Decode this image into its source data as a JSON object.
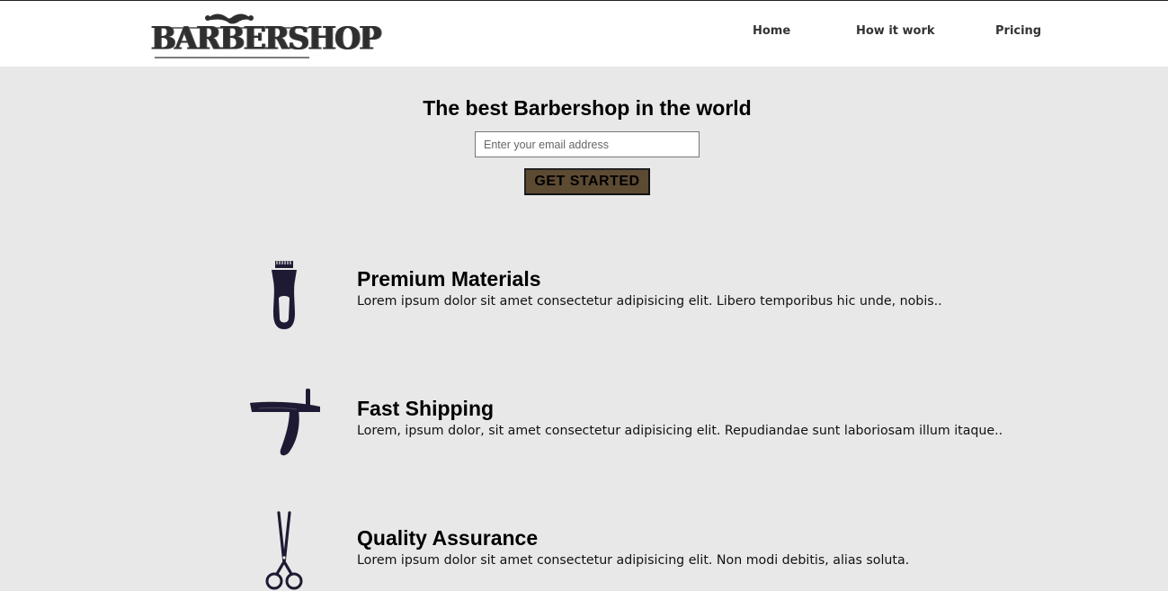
{
  "header": {
    "logo_text": "BARBERSHOP",
    "nav": [
      {
        "label": "Home"
      },
      {
        "label": "How it work"
      },
      {
        "label": "Pricing"
      }
    ]
  },
  "hero": {
    "title": "The best Barbershop in the world",
    "email_placeholder": "Enter your email address",
    "cta_label": "GET STARTED"
  },
  "features": [
    {
      "icon": "hair-clipper-icon",
      "title": "Premium Materials",
      "description": "Lorem ipsum dolor sit amet consectetur adipisicing elit. Libero temporibus hic unde, nobis.."
    },
    {
      "icon": "straight-razor-icon",
      "title": "Fast Shipping",
      "description": "Lorem, ipsum dolor, sit amet consectetur adipisicing elit. Repudiandae sunt laboriosam illum itaque.."
    },
    {
      "icon": "scissors-icon",
      "title": "Quality Assurance",
      "description": "Lorem ipsum dolor sit amet consectetur adipisicing elit. Non modi debitis, alias soluta."
    }
  ],
  "colors": {
    "page_background": "#e8e8e8",
    "header_background": "#ffffff",
    "button_background": "#5c4a32",
    "icon_color": "#1f1a33"
  }
}
